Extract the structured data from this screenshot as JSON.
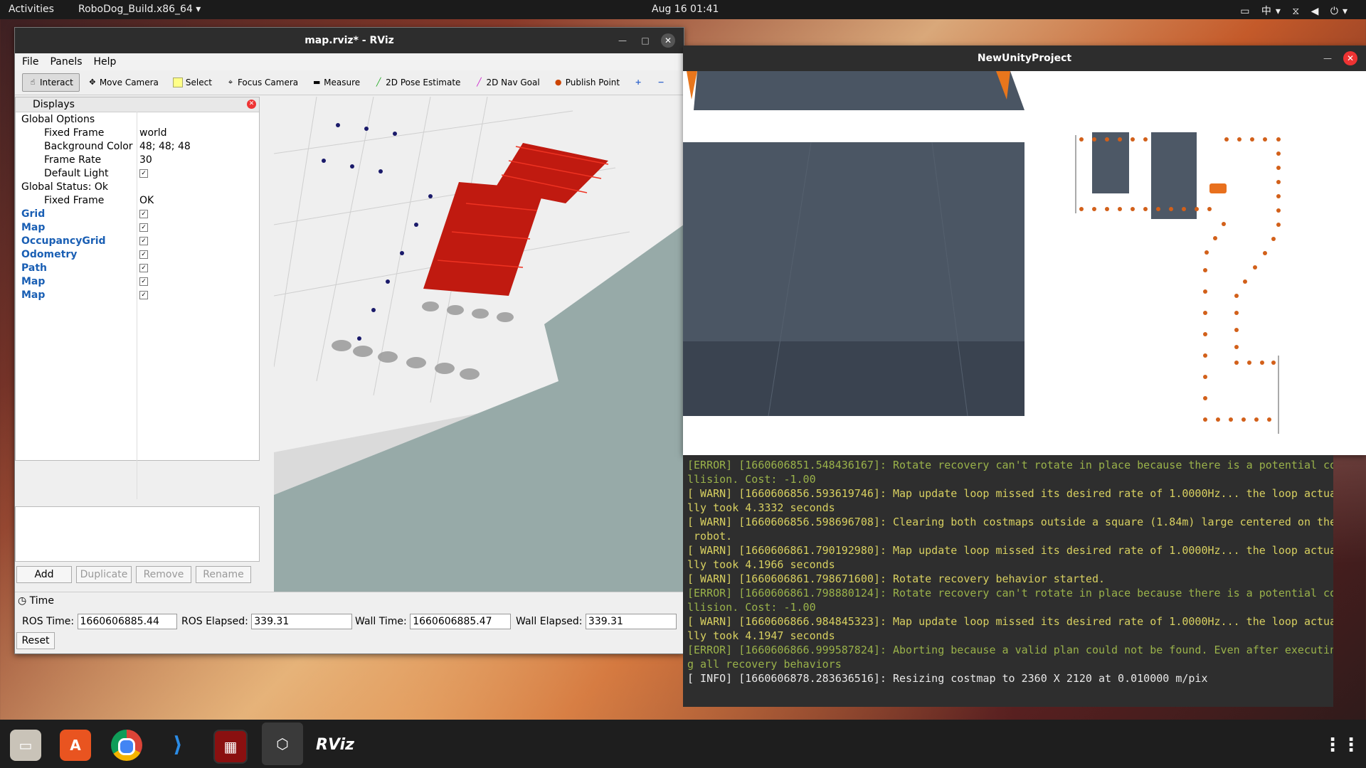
{
  "topbar": {
    "activities": "Activities",
    "app": "RoboDog_Build.x86_64 ▾",
    "clock": "Aug 16  01:41",
    "tray": "▭ 中▾ ⧖ ◀ ⏻▾"
  },
  "rviz": {
    "title": "map.rviz* - RViz",
    "menu": [
      "File",
      "Panels",
      "Help"
    ],
    "toolbar": [
      "Interact",
      "Move Camera",
      "Select",
      "Focus Camera",
      "Measure",
      "2D Pose Estimate",
      "2D Nav Goal",
      "Publish Point"
    ],
    "displays_title": "Displays",
    "tree": [
      {
        "name": "Global Options",
        "value": "",
        "indent": 0,
        "icon": "gear-icon"
      },
      {
        "name": "Fixed Frame",
        "value": "world",
        "indent": 2
      },
      {
        "name": "Background Color",
        "value": "48; 48; 48",
        "indent": 2
      },
      {
        "name": "Frame Rate",
        "value": "30",
        "indent": 2
      },
      {
        "name": "Default Light",
        "value": "✓",
        "indent": 2
      },
      {
        "name": "Global Status: Ok",
        "value": "",
        "indent": 0
      },
      {
        "name": "Fixed Frame",
        "value": "OK",
        "indent": 2
      },
      {
        "name": "Grid",
        "value": "✓",
        "indent": 0
      },
      {
        "name": "Map",
        "value": "✓",
        "indent": 0
      },
      {
        "name": "OccupancyGrid",
        "value": "✓",
        "indent": 0
      },
      {
        "name": "Odometry",
        "value": "✓",
        "indent": 0
      },
      {
        "name": "Path",
        "value": "✓",
        "indent": 0
      },
      {
        "name": "Map",
        "value": "✓",
        "indent": 0
      },
      {
        "name": "Map",
        "value": "✓",
        "indent": 0
      }
    ],
    "buttons": {
      "add": "Add",
      "duplicate": "Duplicate",
      "remove": "Remove",
      "rename": "Rename"
    },
    "time": {
      "title": "Time",
      "ros_time_label": "ROS Time:",
      "ros_time": "1660606885.44",
      "ros_elapsed_label": "ROS Elapsed:",
      "ros_elapsed": "339.31",
      "wall_time_label": "Wall Time:",
      "wall_time": "1660606885.47",
      "wall_elapsed_label": "Wall Elapsed:",
      "wall_elapsed": "339.31",
      "reset": "Reset"
    }
  },
  "unity": {
    "title": "NewUnityProject"
  },
  "terminal": [
    {
      "t": "err",
      "text": "[ERROR] [1660606851.548436167]: Rotate recovery can't rotate in place because there is a potential co"
    },
    {
      "t": "err",
      "text": "llision. Cost: -1.00"
    },
    {
      "t": "warn",
      "text": "[ WARN] [1660606856.593619746]: Map update loop missed its desired rate of 1.0000Hz... the loop actua"
    },
    {
      "t": "warn",
      "text": "lly took 4.3332 seconds"
    },
    {
      "t": "warn",
      "text": "[ WARN] [1660606856.598696708]: Clearing both costmaps outside a square (1.84m) large centered on the"
    },
    {
      "t": "warn",
      "text": " robot."
    },
    {
      "t": "warn",
      "text": "[ WARN] [1660606861.790192980]: Map update loop missed its desired rate of 1.0000Hz... the loop actua"
    },
    {
      "t": "warn",
      "text": "lly took 4.1966 seconds"
    },
    {
      "t": "warn",
      "text": "[ WARN] [1660606861.798671600]: Rotate recovery behavior started."
    },
    {
      "t": "err",
      "text": "[ERROR] [1660606861.798880124]: Rotate recovery can't rotate in place because there is a potential co"
    },
    {
      "t": "err",
      "text": "llision. Cost: -1.00"
    },
    {
      "t": "warn",
      "text": "[ WARN] [1660606866.984845323]: Map update loop missed its desired rate of 1.0000Hz... the loop actua"
    },
    {
      "t": "warn",
      "text": "lly took 4.1947 seconds"
    },
    {
      "t": "err",
      "text": "[ERROR] [1660606866.999587824]: Aborting because a valid plan could not be found. Even after executin"
    },
    {
      "t": "err",
      "text": "g all recovery behaviors"
    },
    {
      "t": "info",
      "text": "[ INFO] [1660606878.283636516]: Resizing costmap to 2360 X 2120 at 0.010000 m/pix"
    }
  ],
  "dock": [
    "files-icon",
    "software-icon",
    "chrome-icon",
    "vscode-icon",
    "terminal-icon",
    "unity-icon",
    "rviz-icon"
  ],
  "dock_labels": {
    "rviz": "RViz"
  }
}
